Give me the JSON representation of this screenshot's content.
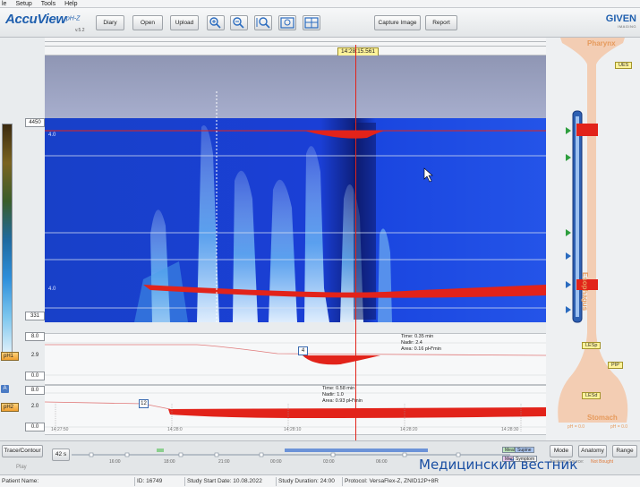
{
  "menu": [
    "le",
    "Setup",
    "Tools",
    "Help"
  ],
  "app": {
    "name": "AccuView",
    "superscript": "pH-Z",
    "version": "v.5.2",
    "company": "GIVEN",
    "company_sub": "IMAGING"
  },
  "toolbar": {
    "diary": "Diary",
    "open": "Open",
    "upload": "Upload",
    "capture_image": "Capture Image",
    "report": "Report"
  },
  "cursor_time": "14:28:15.561",
  "scale": {
    "max": "4450",
    "min": "331"
  },
  "heatmap": {
    "row_label_top": "4.0",
    "row_label_bottom": "4.0"
  },
  "ph1": {
    "channel": "pH1",
    "max": "8.0",
    "mid": "2.9",
    "min": "0.0",
    "event_id": "4",
    "annotation": [
      "Time: 0.35 min",
      "Nadir: 2.4",
      "Area: 0.16 pH*min"
    ]
  },
  "ph2": {
    "a_badge": "A",
    "channel": "pH2",
    "max": "8.0",
    "mid": "2.0",
    "min": "0.0",
    "event_id": "12",
    "annotation": [
      "Time: 0.58 min",
      "Nadir: 1.0",
      "Area: 0.93 pH*min"
    ],
    "x_ticks": [
      "14:27:50",
      "14:28:0",
      "14:28:10",
      "14:28:20",
      "14:28:30"
    ]
  },
  "anatomy": {
    "pharynx": "Pharynx",
    "ues": "UES",
    "esophagus": "Esophagus",
    "lesp": "LESp",
    "pip": "PIP",
    "lesd": "LESd",
    "stomach": "Stomach",
    "ph_left": "pH = 0.0",
    "ph_right": "pH = 0.0",
    "source_label": "Anatomy Source:",
    "source_value": "Not Bought"
  },
  "bottom": {
    "trace_contour": "Trace/Contour",
    "play": "Play",
    "zoom_value": "42 s",
    "mode": "Mode",
    "anatomy": "Anatomy",
    "range": "Range",
    "timeline_ticks": [
      "16:00",
      "18:00",
      "21:00",
      "00:00",
      "03:00",
      "06:00"
    ],
    "tags": {
      "meal": "Meal",
      "supine": "Supine",
      "med": "Med",
      "symptom": "Symptom"
    }
  },
  "status": {
    "patient_name": "Patient Name:",
    "id": "ID: 16749",
    "study_start": "Study Start Date: 10.08.2022",
    "duration": "Study Duration: 24:00",
    "protocol": "Protocol: VersaFlex-Z, ZNID12P+8R"
  },
  "watermark": "Медицинский вестник",
  "colors": {
    "accent": "#1f5fae",
    "pressure_high": "#e2231a",
    "marker": "#fff39a",
    "anatomy": "#f3cdb3"
  }
}
